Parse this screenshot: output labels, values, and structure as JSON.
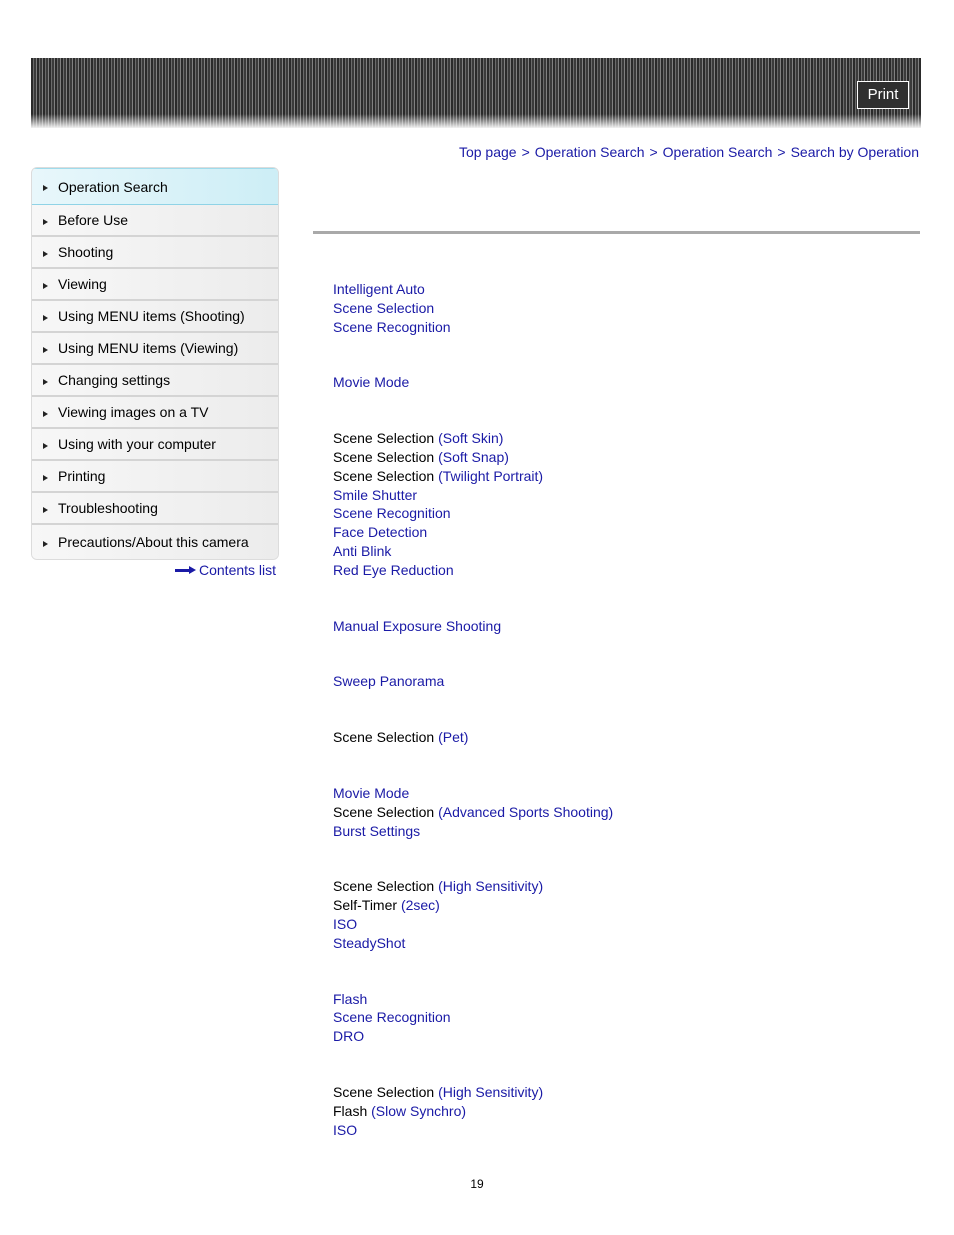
{
  "header": {
    "print_label": "Print"
  },
  "breadcrumb": {
    "items": [
      "Top page",
      "Operation Search",
      "Operation Search",
      "Search by Operation"
    ],
    "separator": ">"
  },
  "sidebar": {
    "items": [
      {
        "label": "Operation Search",
        "active": true
      },
      {
        "label": "Before Use"
      },
      {
        "label": "Shooting"
      },
      {
        "label": "Viewing"
      },
      {
        "label": "Using MENU items (Shooting)"
      },
      {
        "label": "Using MENU items (Viewing)"
      },
      {
        "label": "Changing settings"
      },
      {
        "label": "Viewing images on a TV"
      },
      {
        "label": "Using with your computer"
      },
      {
        "label": "Printing"
      },
      {
        "label": "Troubleshooting"
      },
      {
        "label": "Precautions/About this camera"
      }
    ],
    "contents_link": "Contents list"
  },
  "groups": [
    [
      {
        "link": "Intelligent Auto"
      },
      {
        "link": "Scene Selection"
      },
      {
        "link": "Scene Recognition"
      }
    ],
    [
      {
        "link": "Movie Mode"
      }
    ],
    [
      {
        "prefix": "Scene Selection ",
        "link": "(Soft Skin)"
      },
      {
        "prefix": "Scene Selection ",
        "link": "(Soft Snap)"
      },
      {
        "prefix": "Scene Selection ",
        "link": "(Twilight Portrait)"
      },
      {
        "link": "Smile Shutter"
      },
      {
        "link": "Scene Recognition"
      },
      {
        "link": "Face Detection"
      },
      {
        "link": "Anti Blink"
      },
      {
        "link": "Red Eye Reduction"
      }
    ],
    [
      {
        "link": "Manual Exposure Shooting"
      }
    ],
    [
      {
        "link": "Sweep Panorama"
      }
    ],
    [
      {
        "prefix": "Scene Selection ",
        "link": "(Pet)"
      }
    ],
    [
      {
        "link": "Movie Mode"
      },
      {
        "prefix": "Scene Selection ",
        "link": "(Advanced Sports Shooting)"
      },
      {
        "link": "Burst Settings"
      }
    ],
    [
      {
        "prefix": "Scene Selection ",
        "link": "(High Sensitivity)"
      },
      {
        "prefix": "Self-Timer ",
        "link": "(2sec)"
      },
      {
        "link": "ISO"
      },
      {
        "link": "SteadyShot"
      }
    ],
    [
      {
        "link": "Flash"
      },
      {
        "link": "Scene Recognition"
      },
      {
        "link": "DRO"
      }
    ],
    [
      {
        "prefix": "Scene Selection ",
        "link": "(High Sensitivity)"
      },
      {
        "prefix": "Flash ",
        "link": "(Slow Synchro)"
      },
      {
        "link": "ISO"
      }
    ]
  ],
  "footer": {
    "page_number": "19"
  },
  "colors": {
    "link": "#1a1aa6",
    "active_nav": "#cdeef6",
    "rule": "#a9a9a9"
  }
}
